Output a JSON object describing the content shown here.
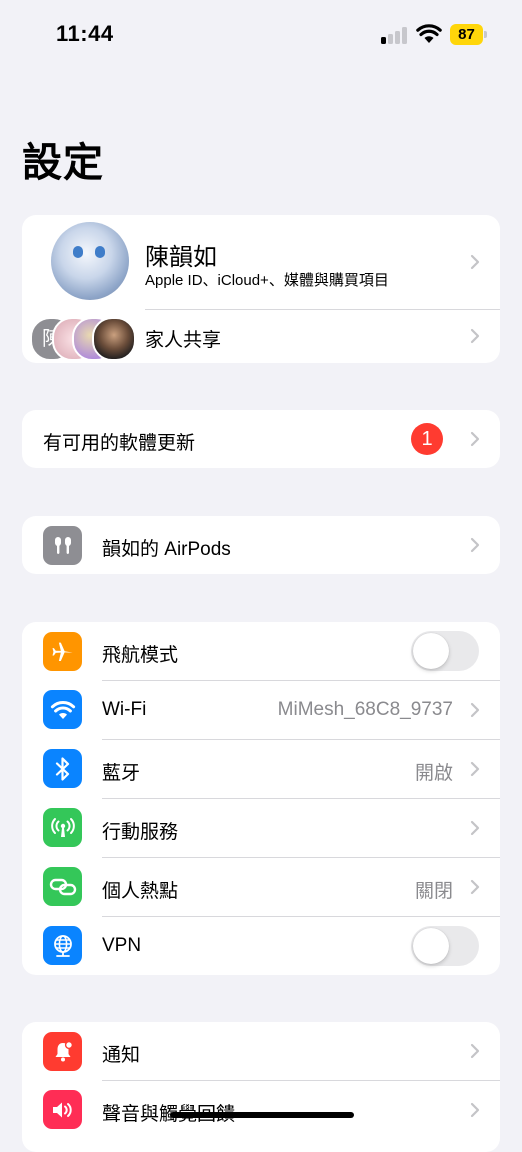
{
  "status_bar": {
    "time": "11:44",
    "battery": "87",
    "battery_color": "#ffd60a"
  },
  "page_title": "設定",
  "profile": {
    "name": "陳韻如",
    "subtitle": "Apple ID、iCloud+、媒體與購買項目",
    "family_label": "家人共享",
    "family_avatar_initial": "陳"
  },
  "update": {
    "label": "有可用的軟體更新",
    "badge": "1"
  },
  "airpods": {
    "label": "韻如的 AirPods",
    "icon": "airpods-icon"
  },
  "connectivity": [
    {
      "label": "飛航模式",
      "icon": "airplane-icon",
      "color": "#ff9500",
      "toggle": false
    },
    {
      "label": "Wi-Fi",
      "icon": "wifi-icon",
      "color": "#0a84ff",
      "value": "MiMesh_68C8_9737"
    },
    {
      "label": "藍牙",
      "icon": "bluetooth-icon",
      "color": "#0a84ff",
      "value": "開啟"
    },
    {
      "label": "行動服務",
      "icon": "antenna-icon",
      "color": "#34c759"
    },
    {
      "label": "個人熱點",
      "icon": "hotspot-icon",
      "color": "#34c759",
      "value": "關閉"
    },
    {
      "label": "VPN",
      "icon": "vpn-globe-icon",
      "color": "#0a84ff",
      "toggle": false
    }
  ],
  "notifications": [
    {
      "label": "通知",
      "icon": "bell-icon",
      "color": "#ff3b30"
    },
    {
      "label": "聲音與觸覺回饋",
      "icon": "speaker-icon",
      "color": "#ff2d55"
    }
  ]
}
